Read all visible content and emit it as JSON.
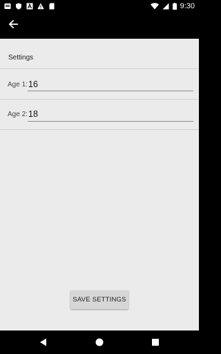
{
  "status_bar": {
    "time": "9:30",
    "icons_left": [
      "message-icon",
      "shield-icon",
      "a-icon",
      "warning-icon",
      "sd-card-icon"
    ],
    "icons_right": [
      "wifi-icon",
      "signal-icon",
      "battery-icon"
    ]
  },
  "app_bar": {
    "back_icon": "arrow-back-icon"
  },
  "settings": {
    "title": "Settings",
    "age1": {
      "label": "Age 1:",
      "value": "16"
    },
    "age2": {
      "label": "Age 2:",
      "value": "18"
    }
  },
  "save_button": {
    "label": "SAVE SETTINGS"
  },
  "nav_bar": {
    "icons": [
      "back-triangle-icon",
      "home-circle-icon",
      "recents-square-icon"
    ]
  },
  "colors": {
    "background": "#ebebeb",
    "bars": "#000000",
    "button": "#d6d6d6"
  }
}
